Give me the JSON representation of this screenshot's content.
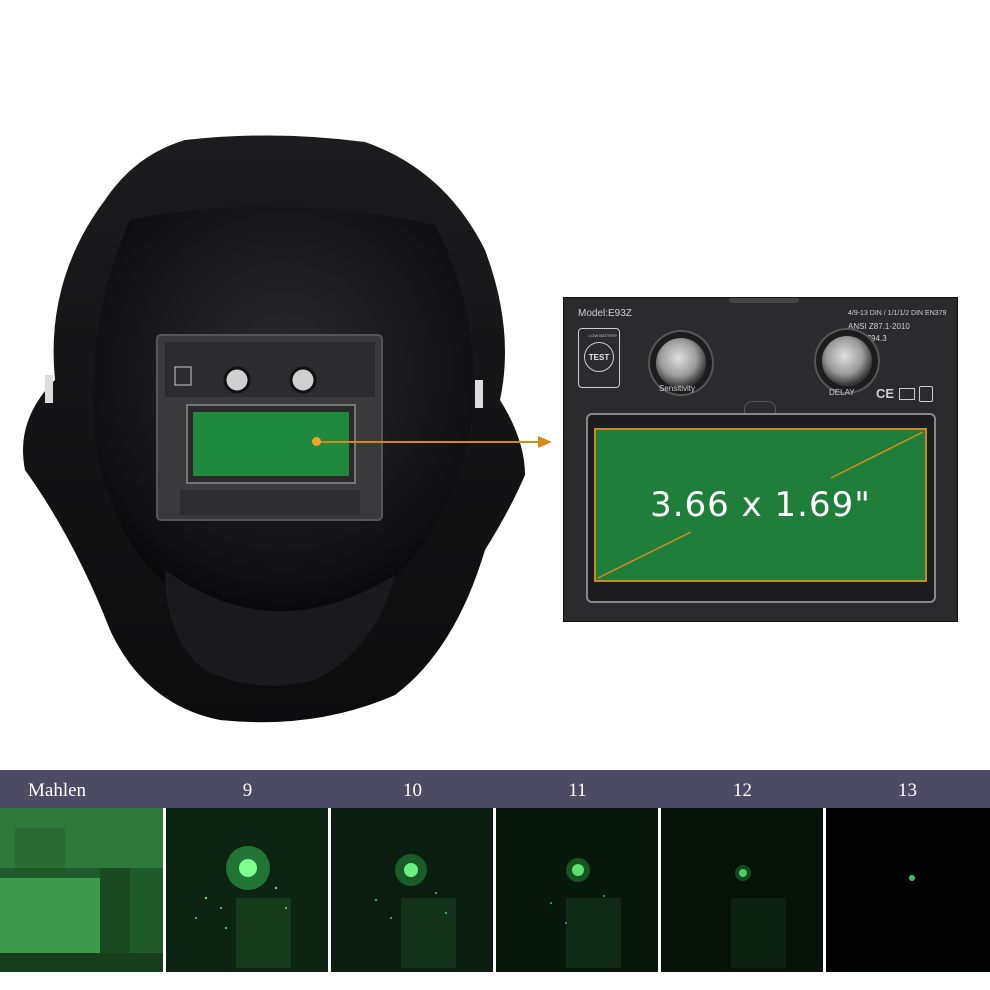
{
  "cartridge": {
    "model": "Model:E93Z",
    "standards_line1": "4/9-13 DIN / 1/1/1/2 DIN EN379",
    "standards_line2": "ANSI Z87.1-2010",
    "standards_line3": "CSA Z94.3",
    "test_button": "TEST",
    "low_battery": "LOW BATTERY",
    "sensitivity_label": "Sensitivity",
    "delay_label": "DELAY",
    "certifications": "CE",
    "lens_size": "3.66 x 1.69\""
  },
  "shade_strip": {
    "labels": [
      "Mahlen",
      "9",
      "10",
      "11",
      "12",
      "13"
    ],
    "colors": {
      "bar": "#4b4c63",
      "accent": "#d4891d",
      "lens": "#1f7f3a"
    }
  }
}
